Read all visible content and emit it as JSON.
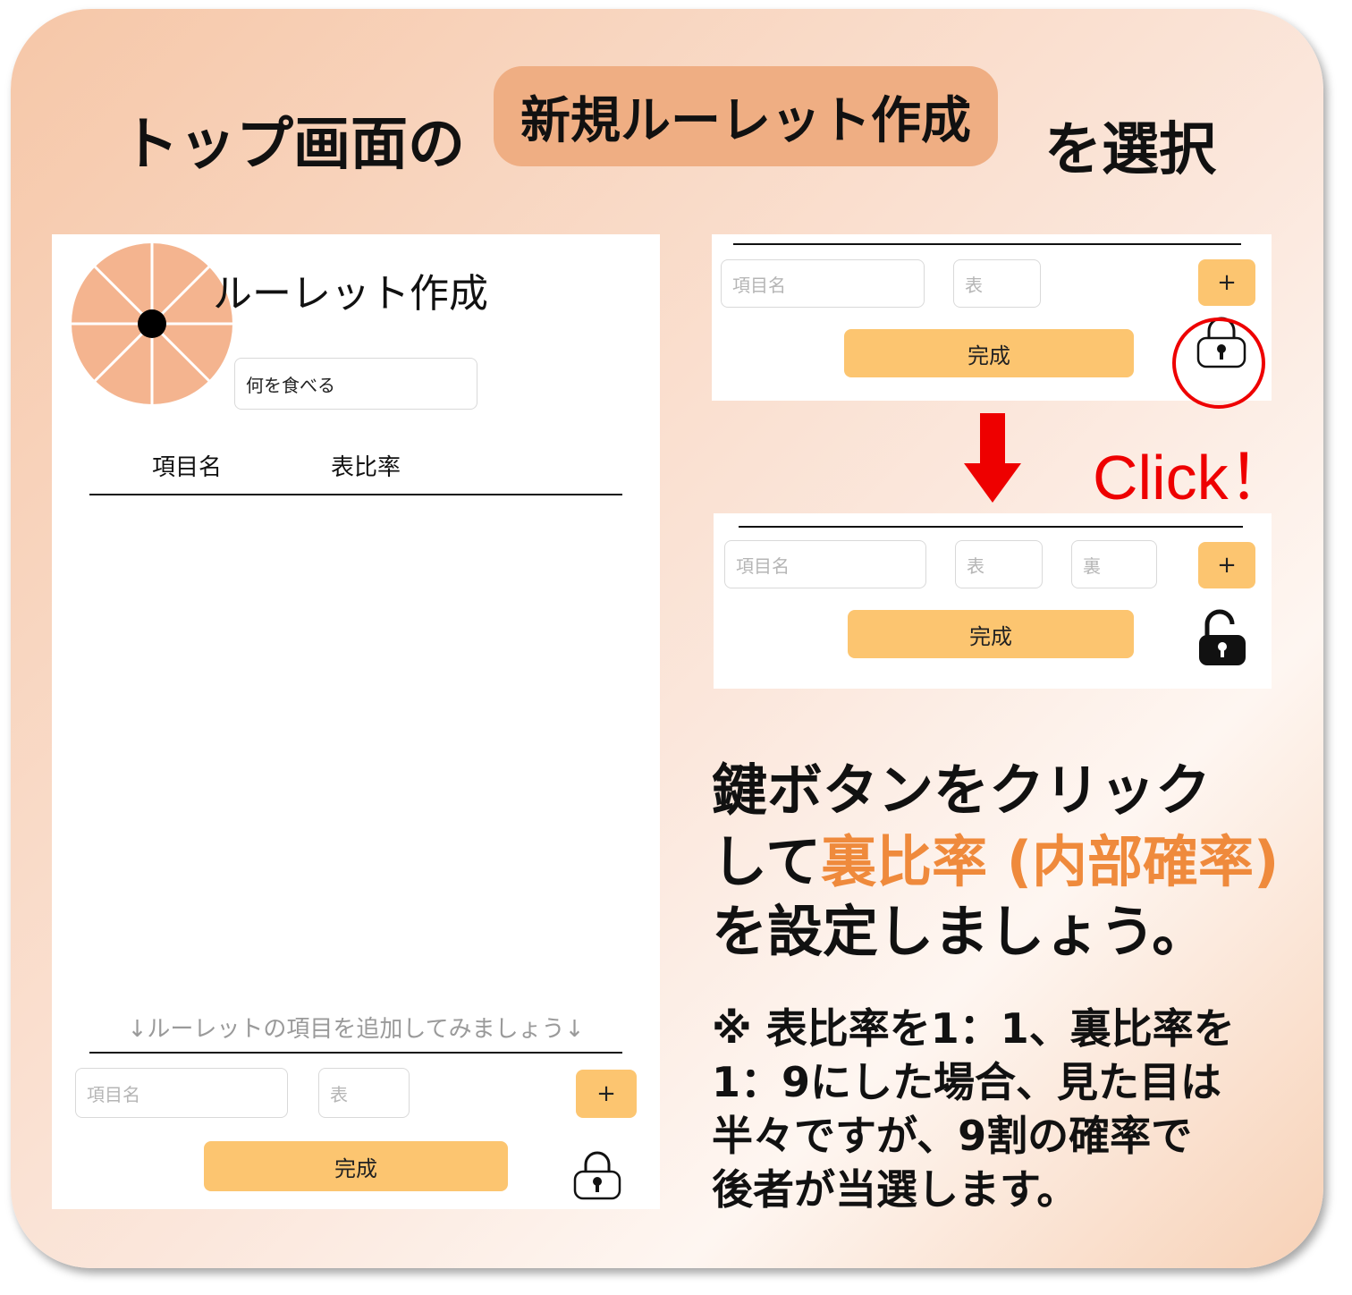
{
  "header": {
    "prefix": "トップ画面の",
    "button_label": "新規ルーレット作成",
    "suffix": "を選択"
  },
  "editor": {
    "title": "ルーレット作成",
    "name_value": "何を食べる",
    "col_item": "項目名",
    "col_ratio": "表比率",
    "hint": "↓ルーレットの項目を追加してみましょう↓",
    "item_placeholder": "項目名",
    "ratio_placeholder": "表",
    "plus_label": "+",
    "done_label": "完成"
  },
  "locked_view": {
    "item_placeholder": "項目名",
    "ratio_placeholder": "表",
    "plus_label": "+",
    "done_label": "完成"
  },
  "click_label": "Click！",
  "unlocked_view": {
    "item_placeholder": "項目名",
    "ratio_placeholder": "表",
    "back_placeholder": "裏",
    "plus_label": "+",
    "done_label": "完成"
  },
  "instruction": {
    "line1": "鍵ボタンをクリック",
    "line2_prefix": "して",
    "line2_highlight": "裏比率 (内部確率)",
    "line3": "を設定しましょう。"
  },
  "note": {
    "line1": "※ 表比率を1：1、裏比率を",
    "line2": "1：9にした場合、見た目は",
    "line3": "半々ですが、9割の確率で",
    "line4": "後者が当選します。"
  },
  "colors": {
    "accent_orange": "#ef8a3c",
    "button_yellow": "#fcc570",
    "pill_orange": "#efae83",
    "wheel": "#f4b48f",
    "click_red": "#ee0000"
  }
}
